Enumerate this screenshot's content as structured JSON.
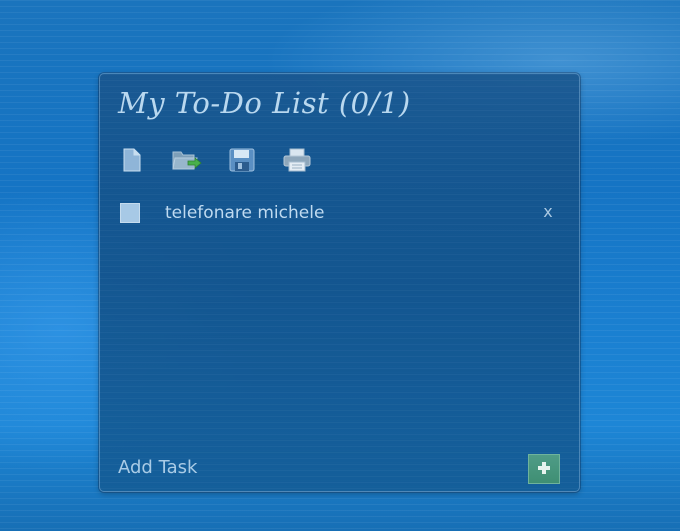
{
  "gadget": {
    "title": "My To-Do List (0/1)",
    "toolbar": {
      "icons": [
        "new-document-icon",
        "open-folder-icon",
        "save-disk-icon",
        "print-icon"
      ]
    },
    "tasks": [
      {
        "text": "telefonare michele",
        "checked": false,
        "delete_label": "x"
      }
    ],
    "add_task_label": "Add Task",
    "add_button_icon": "plus-icon"
  }
}
